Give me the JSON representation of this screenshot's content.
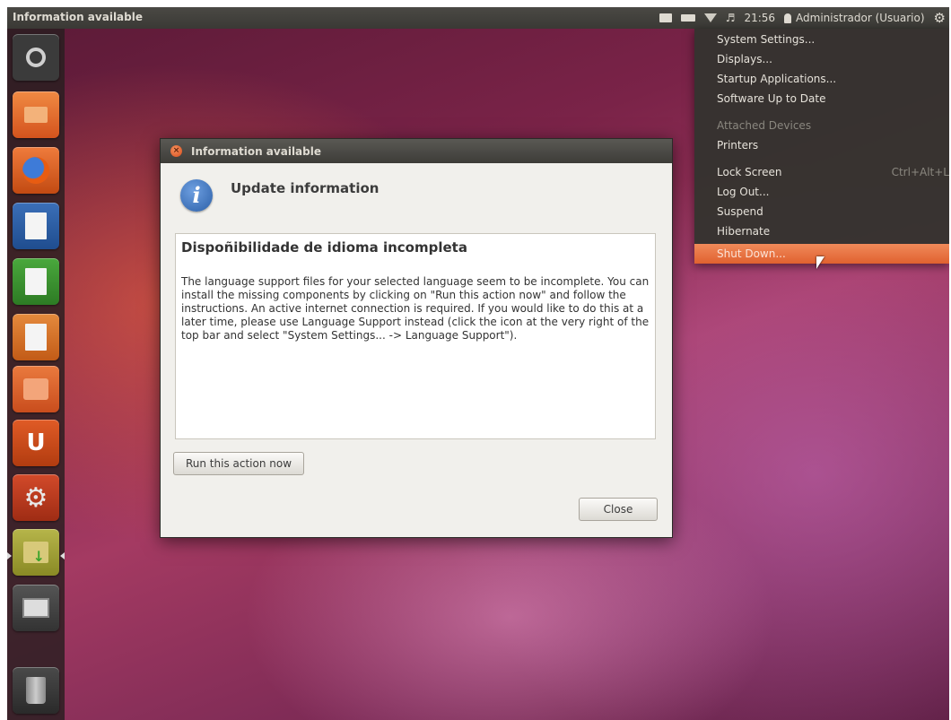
{
  "panel": {
    "title": "Information available",
    "time": "21:56",
    "user": "Administrador (Usuario)",
    "icons": [
      "envelope-icon",
      "battery-icon",
      "wifi-icon",
      "sound-icon",
      "user-icon",
      "gear-icon"
    ]
  },
  "launcher": {
    "items": [
      "dash",
      "home-folder",
      "firefox",
      "libreoffice-writer",
      "libreoffice-calc",
      "libreoffice-impress",
      "software-center",
      "ubuntu-one",
      "system-settings",
      "update-manager",
      "workspace-switcher",
      "trash"
    ],
    "ubuntuone_letter": "U"
  },
  "dialog": {
    "title": "Information available",
    "heading": "Update information",
    "content_title": "Dispoñibilidade de idioma incompleta",
    "content_body": "The language support files for your selected language seem to be incomplete. You can install the missing components by clicking on \"Run this action now\" and follow the instructions. An active internet connection is required. If you would like to do this at a later time, please use Language Support instead (click the icon at the very right of the top bar and select \"System Settings... -> Language Support\").",
    "run_button": "Run this action now",
    "close_button": "Close"
  },
  "menu": {
    "items": [
      {
        "label": "System Settings..."
      },
      {
        "label": "Displays..."
      },
      {
        "label": "Startup Applications..."
      },
      {
        "label": "Software Up to Date"
      },
      {
        "label": "Attached Devices"
      },
      {
        "label": "Printers"
      },
      {
        "label": "Lock Screen",
        "shortcut": "Ctrl+Alt+L"
      },
      {
        "label": "Log Out..."
      },
      {
        "label": "Suspend"
      },
      {
        "label": "Hibernate"
      },
      {
        "label": "Shut Down..."
      }
    ]
  },
  "colors": {
    "panel_bg": "#3a3935",
    "accent_orange": "#e0612f",
    "dialog_bg": "#f1f0ec"
  }
}
